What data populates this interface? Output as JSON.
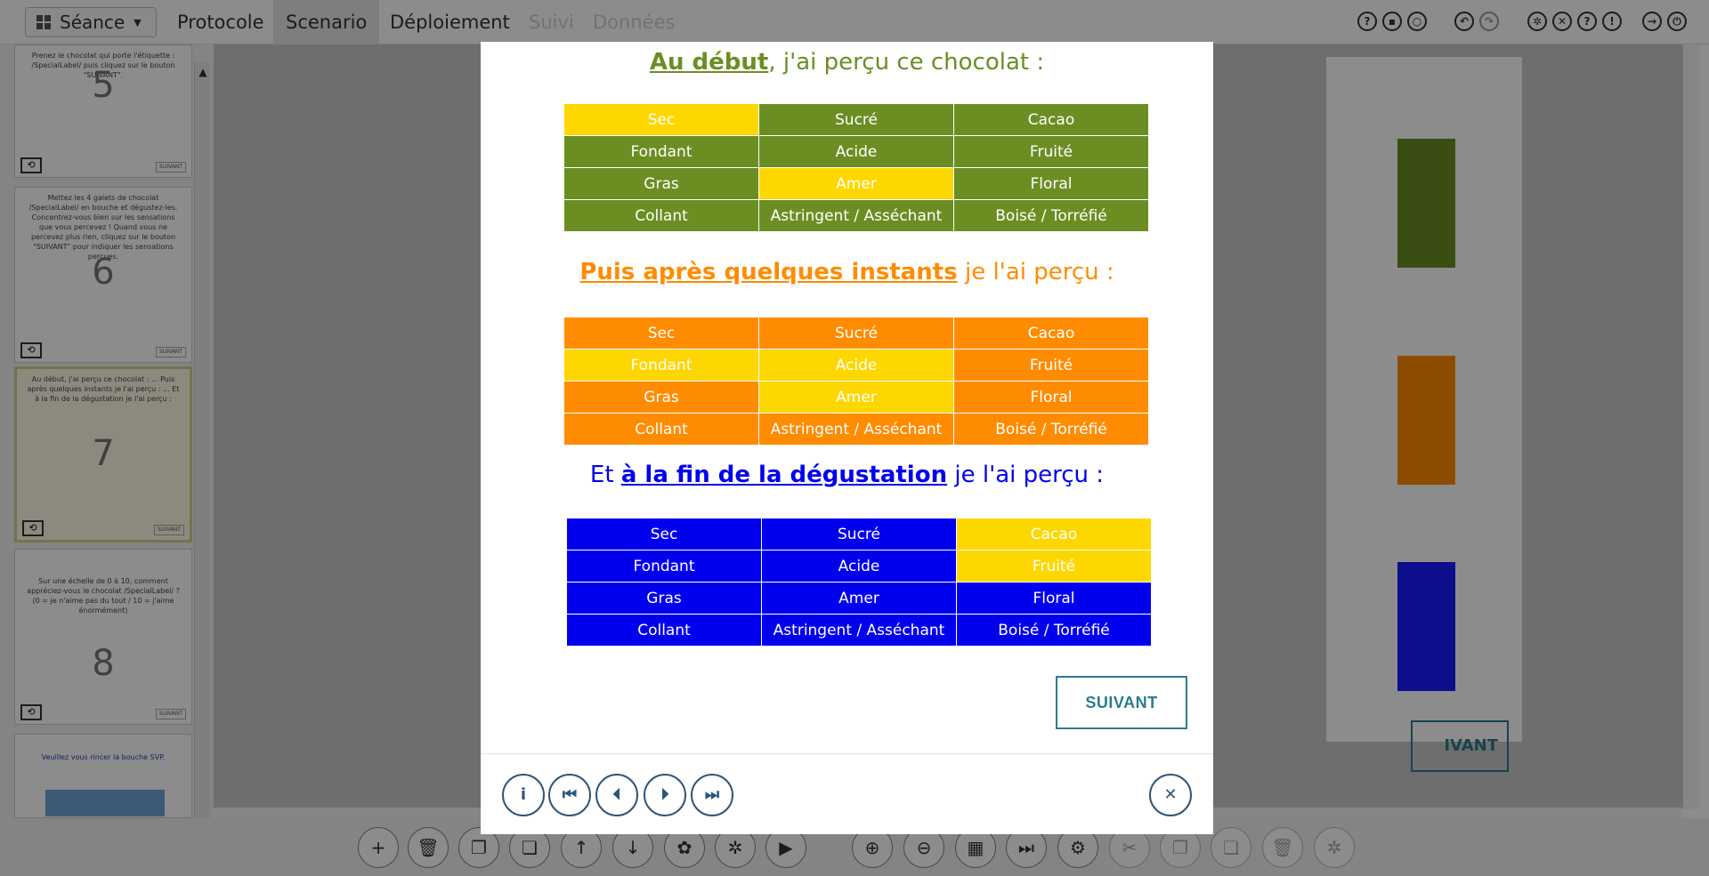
{
  "topbar": {
    "seance_label": "Séance",
    "tabs": [
      {
        "label": "Protocole",
        "state": "normal"
      },
      {
        "label": "Scenario",
        "state": "active"
      },
      {
        "label": "Déploiement",
        "state": "normal"
      },
      {
        "label": "Suivi",
        "state": "disabled"
      },
      {
        "label": "Données",
        "state": "disabled"
      }
    ],
    "right_icons": [
      "help-icon",
      "save-icon",
      "unlock-icon",
      "undo-icon",
      "redo-icon",
      "settings-icon",
      "fullscreen-icon",
      "question-icon",
      "info-icon",
      "logout-icon",
      "power-icon"
    ]
  },
  "sidebar": {
    "thumbs": [
      {
        "number": "5",
        "text": "Prenez le chocolat qui porte l'étiquette : /SpecialLabel/ puis cliquez sur le bouton \"SUIVANT\".",
        "button": "SUIVANT"
      },
      {
        "number": "6",
        "text": "Mettez les 4 galets de chocolat /SpecialLabel/ en bouche et dégustez-les. Concentrez-vous bien sur les sensations que vous percevez ! Quand vous ne percevez plus rien, cliquez sur le bouton \"SUIVANT\" pour indiquer les sensations perçues.",
        "button": "SUIVANT"
      },
      {
        "number": "7",
        "text": "Au début, j'ai perçu ce chocolat : ... Puis après quelques instants je l'ai perçu : ... Et à la fin de la dégustation je l'ai perçu :",
        "button": "SUIVANT"
      },
      {
        "number": "8",
        "text": "Sur une échelle de 0 à 10, comment appréciez-vous le chocolat /SpecialLabel/ ? (0 = je n'aime pas du tout / 10 = j'aime énormément)",
        "button": "SUIVANT"
      },
      {
        "number": "",
        "text": "Veuillez vous rincer la bouche SVP.",
        "button": ""
      }
    ]
  },
  "modal": {
    "section1": {
      "emphasis": "Au début",
      "rest": ", j'ai perçu ce chocolat :",
      "color": "#6b8e23",
      "highlight": "#ffd700"
    },
    "section2": {
      "emphasis": "Puis après quelques instants",
      "rest": " je l'ai perçu :",
      "color": "#ff8c00",
      "highlight": "#ffd700"
    },
    "section3": {
      "pre": "Et ",
      "emphasis": "à la fin de la dégustation",
      "rest": " je l'ai perçu :",
      "color": "#0000ee",
      "highlight": "#ffd700"
    },
    "table1": [
      [
        {
          "t": "Sec",
          "on": true
        },
        {
          "t": "Sucré",
          "on": false
        },
        {
          "t": "Cacao",
          "on": false
        }
      ],
      [
        {
          "t": "Fondant",
          "on": false
        },
        {
          "t": "Acide",
          "on": false
        },
        {
          "t": "Fruité",
          "on": false
        }
      ],
      [
        {
          "t": "Gras",
          "on": false
        },
        {
          "t": "Amer",
          "on": true
        },
        {
          "t": "Floral",
          "on": false
        }
      ],
      [
        {
          "t": "Collant",
          "on": false
        },
        {
          "t": "Astringent / Asséchant",
          "on": false
        },
        {
          "t": "Boisé / Torréfié",
          "on": false
        }
      ]
    ],
    "table2": [
      [
        {
          "t": "Sec",
          "on": false
        },
        {
          "t": "Sucré",
          "on": false
        },
        {
          "t": "Cacao",
          "on": false
        }
      ],
      [
        {
          "t": "Fondant",
          "on": true
        },
        {
          "t": "Acide",
          "on": true
        },
        {
          "t": "Fruité",
          "on": false
        }
      ],
      [
        {
          "t": "Gras",
          "on": false
        },
        {
          "t": "Amer",
          "on": true
        },
        {
          "t": "Floral",
          "on": false
        }
      ],
      [
        {
          "t": "Collant",
          "on": false
        },
        {
          "t": "Astringent / Asséchant",
          "on": false
        },
        {
          "t": "Boisé / Torréfié",
          "on": false
        }
      ]
    ],
    "table3": [
      [
        {
          "t": "Sec",
          "on": false
        },
        {
          "t": "Sucré",
          "on": false
        },
        {
          "t": "Cacao",
          "on": true
        }
      ],
      [
        {
          "t": "Fondant",
          "on": false
        },
        {
          "t": "Acide",
          "on": false
        },
        {
          "t": "Fruité",
          "on": true
        }
      ],
      [
        {
          "t": "Gras",
          "on": false
        },
        {
          "t": "Amer",
          "on": false
        },
        {
          "t": "Floral",
          "on": false
        }
      ],
      [
        {
          "t": "Collant",
          "on": false
        },
        {
          "t": "Astringent / Asséchant",
          "on": false
        },
        {
          "t": "Boisé / Torréfié",
          "on": false
        }
      ]
    ],
    "suivant_label": "SUIVANT",
    "footer_icons": [
      "info-icon",
      "first-page-icon",
      "previous-page-icon",
      "next-page-icon",
      "last-page-icon",
      "close-icon"
    ]
  },
  "background": {
    "suivant_fragment": "IVANT"
  },
  "bottombar": {
    "icons": [
      "add-icon",
      "delete-icon",
      "copy-icon",
      "paste-icon",
      "move-up-icon",
      "move-down-icon",
      "palette-icon",
      "settings-icon",
      "play-icon",
      "zoom-in-icon",
      "zoom-out-icon",
      "grid-icon",
      "skip-icon",
      "group-icon",
      "cut-icon",
      "copy-icon",
      "paste-icon",
      "delete-icon",
      "settings-icon"
    ]
  }
}
